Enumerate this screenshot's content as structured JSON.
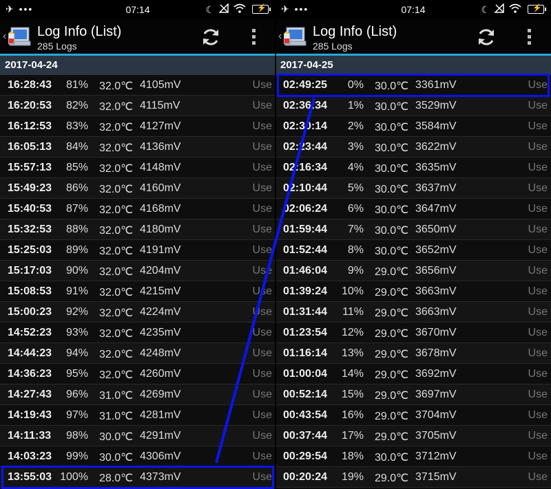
{
  "status_bar": {
    "time": "07:14",
    "left_icons": [
      "airplane-icon",
      "more-dots-icon"
    ],
    "right_icons": [
      "moon-icon",
      "signal-off-icon",
      "wifi-icon",
      "battery-charging-icon"
    ]
  },
  "panels": [
    {
      "title": "Log Info (List)",
      "subtitle": "285 Logs",
      "date": "2017-04-24",
      "rows": [
        {
          "time": "16:28:43",
          "pct": "81%",
          "temp": "32.0℃",
          "mv": "4105mV",
          "use": "Use"
        },
        {
          "time": "16:20:53",
          "pct": "82%",
          "temp": "32.0℃",
          "mv": "4115mV",
          "use": "Use"
        },
        {
          "time": "16:12:53",
          "pct": "83%",
          "temp": "32.0℃",
          "mv": "4127mV",
          "use": "Use"
        },
        {
          "time": "16:05:13",
          "pct": "84%",
          "temp": "32.0℃",
          "mv": "4136mV",
          "use": "Use"
        },
        {
          "time": "15:57:13",
          "pct": "85%",
          "temp": "32.0℃",
          "mv": "4148mV",
          "use": "Use"
        },
        {
          "time": "15:49:23",
          "pct": "86%",
          "temp": "32.0℃",
          "mv": "4160mV",
          "use": "Use"
        },
        {
          "time": "15:40:53",
          "pct": "87%",
          "temp": "32.0℃",
          "mv": "4168mV",
          "use": "Use"
        },
        {
          "time": "15:32:53",
          "pct": "88%",
          "temp": "32.0℃",
          "mv": "4180mV",
          "use": "Use"
        },
        {
          "time": "15:25:03",
          "pct": "89%",
          "temp": "32.0℃",
          "mv": "4191mV",
          "use": "Use"
        },
        {
          "time": "15:17:03",
          "pct": "90%",
          "temp": "32.0℃",
          "mv": "4204mV",
          "use": "Use"
        },
        {
          "time": "15:08:53",
          "pct": "91%",
          "temp": "32.0℃",
          "mv": "4215mV",
          "use": "Use"
        },
        {
          "time": "15:00:23",
          "pct": "92%",
          "temp": "32.0℃",
          "mv": "4224mV",
          "use": "Use"
        },
        {
          "time": "14:52:23",
          "pct": "93%",
          "temp": "32.0℃",
          "mv": "4235mV",
          "use": "Use"
        },
        {
          "time": "14:44:23",
          "pct": "94%",
          "temp": "32.0℃",
          "mv": "4248mV",
          "use": "Use"
        },
        {
          "time": "14:36:23",
          "pct": "95%",
          "temp": "32.0℃",
          "mv": "4260mV",
          "use": "Use"
        },
        {
          "time": "14:27:43",
          "pct": "96%",
          "temp": "31.0℃",
          "mv": "4269mV",
          "use": "Use"
        },
        {
          "time": "14:19:43",
          "pct": "97%",
          "temp": "31.0℃",
          "mv": "4281mV",
          "use": "Use"
        },
        {
          "time": "14:11:33",
          "pct": "98%",
          "temp": "30.0℃",
          "mv": "4291mV",
          "use": "Use"
        },
        {
          "time": "14:03:23",
          "pct": "99%",
          "temp": "30.0℃",
          "mv": "4306mV",
          "use": "Use"
        },
        {
          "time": "13:55:03",
          "pct": "100%",
          "temp": "28.0℃",
          "mv": "4373mV",
          "use": "Use",
          "highlighted": true
        }
      ]
    },
    {
      "title": "Log Info (List)",
      "subtitle": "285 Logs",
      "date": "2017-04-25",
      "rows": [
        {
          "time": "02:49:25",
          "pct": "0%",
          "temp": "30.0℃",
          "mv": "3361mV",
          "use": "Use",
          "highlighted": true
        },
        {
          "time": "02:36:34",
          "pct": "1%",
          "temp": "30.0℃",
          "mv": "3529mV",
          "use": "Use"
        },
        {
          "time": "02:30:14",
          "pct": "2%",
          "temp": "30.0℃",
          "mv": "3584mV",
          "use": "Use"
        },
        {
          "time": "02:23:44",
          "pct": "3%",
          "temp": "30.0℃",
          "mv": "3622mV",
          "use": "Use"
        },
        {
          "time": "02:16:34",
          "pct": "4%",
          "temp": "30.0℃",
          "mv": "3635mV",
          "use": "Use"
        },
        {
          "time": "02:10:44",
          "pct": "5%",
          "temp": "30.0℃",
          "mv": "3637mV",
          "use": "Use"
        },
        {
          "time": "02:06:24",
          "pct": "6%",
          "temp": "30.0℃",
          "mv": "3647mV",
          "use": "Use"
        },
        {
          "time": "01:59:44",
          "pct": "7%",
          "temp": "30.0℃",
          "mv": "3650mV",
          "use": "Use"
        },
        {
          "time": "01:52:44",
          "pct": "8%",
          "temp": "30.0℃",
          "mv": "3652mV",
          "use": "Use"
        },
        {
          "time": "01:46:04",
          "pct": "9%",
          "temp": "29.0℃",
          "mv": "3656mV",
          "use": "Use"
        },
        {
          "time": "01:39:24",
          "pct": "10%",
          "temp": "29.0℃",
          "mv": "3663mV",
          "use": "Use"
        },
        {
          "time": "01:31:44",
          "pct": "11%",
          "temp": "29.0℃",
          "mv": "3663mV",
          "use": "Use"
        },
        {
          "time": "01:23:54",
          "pct": "12%",
          "temp": "29.0℃",
          "mv": "3670mV",
          "use": "Use"
        },
        {
          "time": "01:16:14",
          "pct": "13%",
          "temp": "29.0℃",
          "mv": "3678mV",
          "use": "Use"
        },
        {
          "time": "01:00:04",
          "pct": "14%",
          "temp": "29.0℃",
          "mv": "3692mV",
          "use": "Use"
        },
        {
          "time": "00:52:14",
          "pct": "15%",
          "temp": "29.0℃",
          "mv": "3697mV",
          "use": "Use"
        },
        {
          "time": "00:43:54",
          "pct": "16%",
          "temp": "29.0℃",
          "mv": "3704mV",
          "use": "Use"
        },
        {
          "time": "00:37:44",
          "pct": "17%",
          "temp": "29.0℃",
          "mv": "3705mV",
          "use": "Use"
        },
        {
          "time": "00:29:54",
          "pct": "18%",
          "temp": "30.0℃",
          "mv": "3712mV",
          "use": "Use"
        },
        {
          "time": "00:20:24",
          "pct": "19%",
          "temp": "29.0℃",
          "mv": "3715mV",
          "use": "Use"
        }
      ]
    }
  ],
  "colors": {
    "accent": "#2aa7d6",
    "date_header_bg": "#2b3644",
    "highlight": "#0a14f0"
  }
}
